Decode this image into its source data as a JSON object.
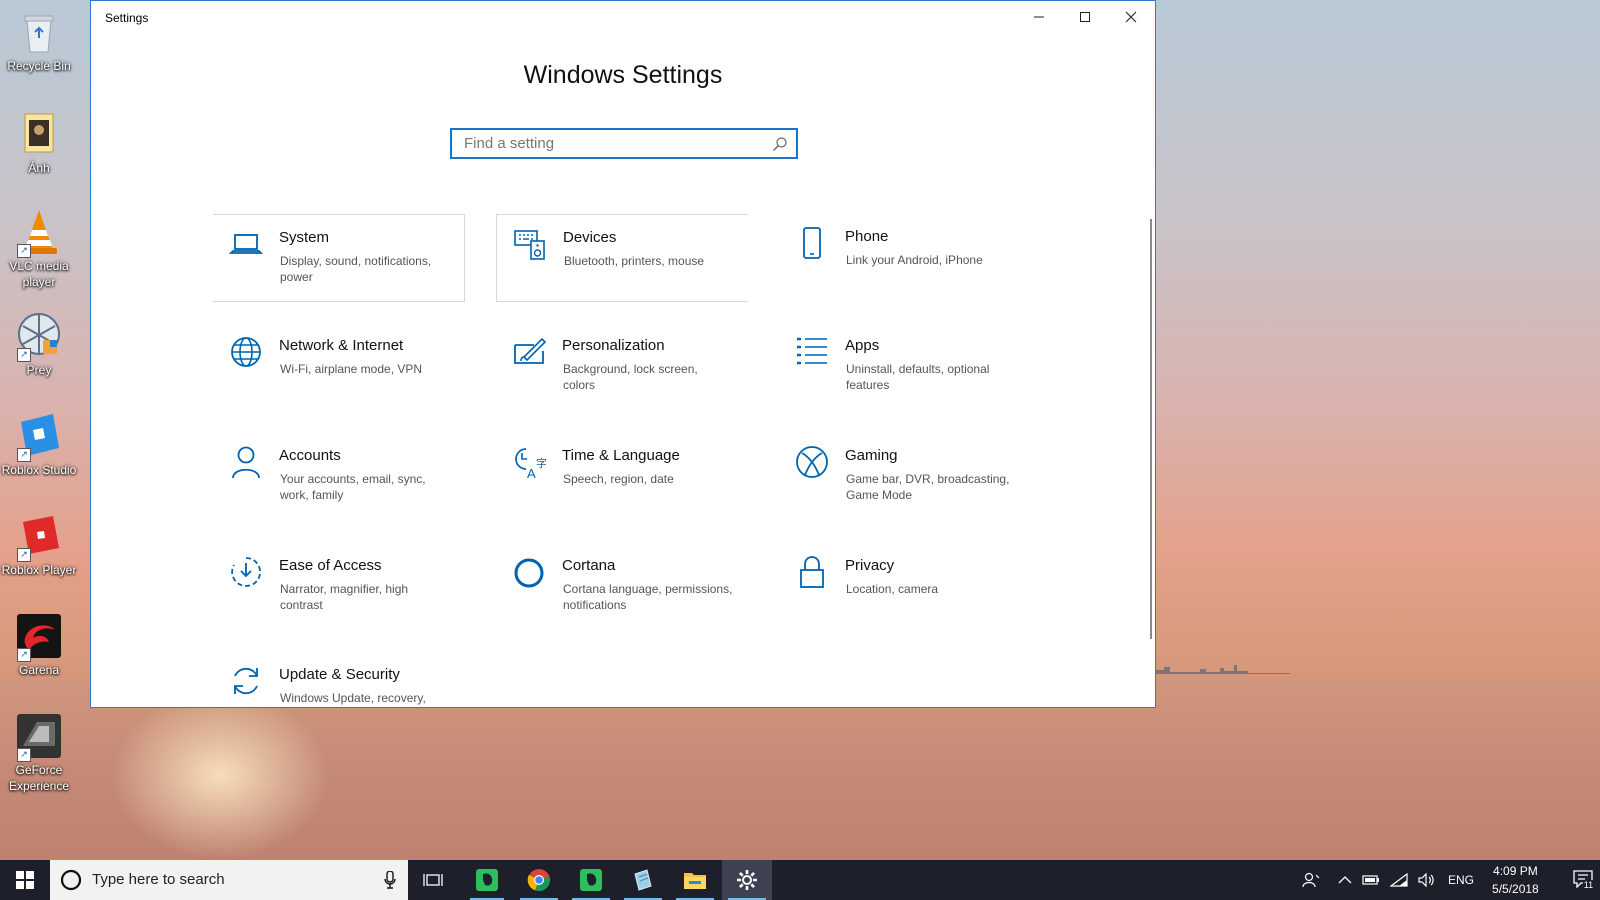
{
  "desktop": {
    "icons": [
      {
        "label": "Recycle Bin"
      },
      {
        "label": "Ảnh"
      },
      {
        "label": "VLC media player"
      },
      {
        "label": "Prey"
      },
      {
        "label": "Roblox Studio"
      },
      {
        "label": "Roblox Player"
      },
      {
        "label": "Garena"
      },
      {
        "label": "GeForce Experience"
      }
    ]
  },
  "window": {
    "title": "Settings",
    "heading": "Windows Settings",
    "search_placeholder": "Find a setting",
    "tiles": [
      {
        "name": "System",
        "desc": "Display, sound, notifications, power",
        "icon": "laptop-icon"
      },
      {
        "name": "Devices",
        "desc": "Bluetooth, printers, mouse",
        "icon": "keyboard-speaker-icon"
      },
      {
        "name": "Phone",
        "desc": "Link your Android, iPhone",
        "icon": "phone-icon"
      },
      {
        "name": "Network & Internet",
        "desc": "Wi-Fi, airplane mode, VPN",
        "icon": "globe-icon"
      },
      {
        "name": "Personalization",
        "desc": "Background, lock screen, colors",
        "icon": "paint-icon"
      },
      {
        "name": "Apps",
        "desc": "Uninstall, defaults, optional features",
        "icon": "list-icon"
      },
      {
        "name": "Accounts",
        "desc": "Your accounts, email, sync, work, family",
        "icon": "person-icon"
      },
      {
        "name": "Time & Language",
        "desc": "Speech, region, date",
        "icon": "time-language-icon"
      },
      {
        "name": "Gaming",
        "desc": "Game bar, DVR, broadcasting, Game Mode",
        "icon": "xbox-icon"
      },
      {
        "name": "Ease of Access",
        "desc": "Narrator, magnifier, high contrast",
        "icon": "ease-of-access-icon"
      },
      {
        "name": "Cortana",
        "desc": "Cortana language, permissions, notifications",
        "icon": "cortana-icon"
      },
      {
        "name": "Privacy",
        "desc": "Location, camera",
        "icon": "lock-icon"
      },
      {
        "name": "Update & Security",
        "desc": "Windows Update, recovery, backup",
        "icon": "sync-icon"
      }
    ]
  },
  "taskbar": {
    "search_placeholder": "Type here to search",
    "language": "ENG",
    "time": "4:09 PM",
    "date": "5/5/2018",
    "notification_count": "11"
  },
  "colors": {
    "accent": "#0063b1",
    "titlebar_border": "#2b79d0",
    "taskbar": "#1d1f2a"
  }
}
